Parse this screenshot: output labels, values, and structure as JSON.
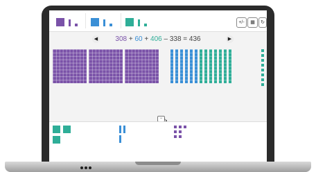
{
  "toolbar": {
    "modes": [
      {
        "name": "place-value-mode-1",
        "color": "#7a52a8"
      },
      {
        "name": "place-value-mode-2",
        "color": "#3a8fd6"
      },
      {
        "name": "place-value-mode-3",
        "color": "#2fae98"
      }
    ],
    "buttons": [
      {
        "name": "expand-button",
        "icon": "plus-minus-icon",
        "glyph": "+/-"
      },
      {
        "name": "grid-button",
        "icon": "grid-icon",
        "glyph": "▦"
      },
      {
        "name": "reset-button",
        "icon": "refresh-icon",
        "glyph": "↻"
      }
    ]
  },
  "equation": {
    "prev_glyph": "◀",
    "next_glyph": "▶",
    "terms": [
      {
        "text": "308",
        "color": "#7a52a8"
      },
      {
        "text": " + ",
        "color": "#444444"
      },
      {
        "text": "60",
        "color": "#3a8fd6"
      },
      {
        "text": " + ",
        "color": "#444444"
      },
      {
        "text": "406",
        "color": "#2fae98"
      },
      {
        "text": " – 338 = 436",
        "color": "#444444"
      }
    ]
  },
  "canvas": {
    "hundreds_color": "#7a52a8",
    "tens_blue_color": "#3a8fd6",
    "tens_green_color": "#2fae98",
    "ones_color": "#2fae98",
    "hundreds_count": 3,
    "tens_blue_count": 6,
    "tens_green_count": 7,
    "ones_count": 8,
    "collapse_glyph": "−",
    "collapse_arrow": "↘"
  },
  "tray": {
    "hundred_color": "#2fae98",
    "ten_color": "#3a8fd6",
    "one_color": "#7a52a8"
  }
}
